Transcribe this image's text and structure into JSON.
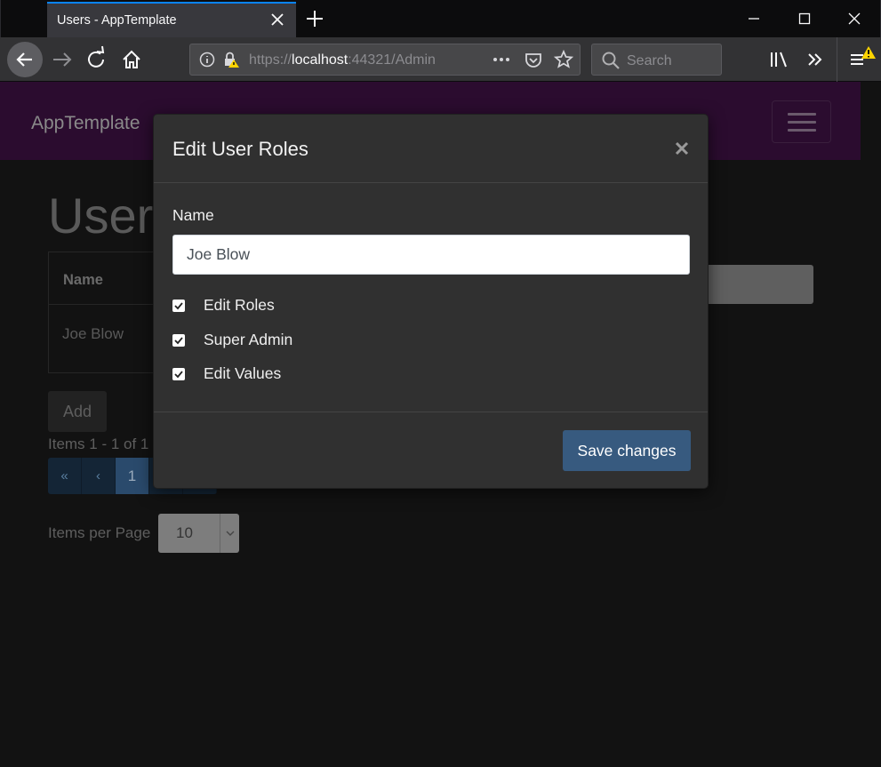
{
  "browser": {
    "tab_title": "Users - AppTemplate",
    "url_secure": "https://",
    "url_host": "localhost",
    "url_rest": ":44321/Admin",
    "search_placeholder": "Search"
  },
  "page": {
    "brand": "AppTemplate",
    "title": "Users",
    "table": {
      "headers": [
        "Name"
      ],
      "rows": [
        [
          "Joe Blow"
        ]
      ]
    },
    "add_label": "Add",
    "items_text": "Items 1 - 1 of 1",
    "pagination": [
      "«",
      "‹",
      "1",
      "›",
      "»"
    ],
    "active_page": "1",
    "per_page_label": "Items per Page",
    "per_page_value": "10"
  },
  "modal": {
    "title": "Edit User Roles",
    "name_label": "Name",
    "name_value": "Joe Blow",
    "roles": [
      {
        "label": "Edit Roles",
        "checked": true
      },
      {
        "label": "Super Admin",
        "checked": true
      },
      {
        "label": "Edit Values",
        "checked": true
      }
    ],
    "save_label": "Save changes"
  },
  "colors": {
    "accent_tab": "#0a84ff",
    "navbar_bg": "#2b0c2f",
    "modal_bg": "#303030",
    "primary_button": "#375a7f",
    "warning_badge": "#ffd400"
  }
}
